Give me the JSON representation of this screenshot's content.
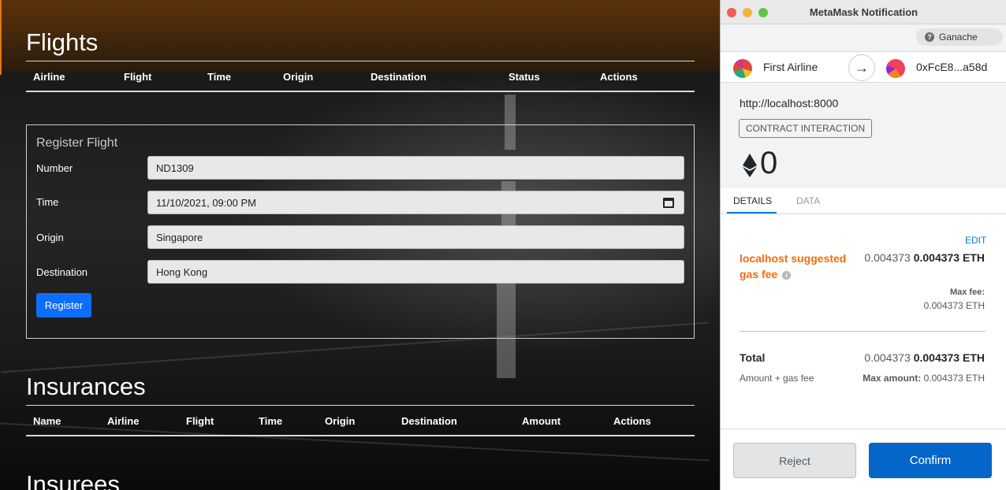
{
  "dapp": {
    "flights_title": "Flights",
    "flights_columns": [
      "Airline",
      "Flight",
      "Time",
      "Origin",
      "Destination",
      "Status",
      "Actions"
    ],
    "register": {
      "legend": "Register Flight",
      "fields": [
        {
          "label": "Number",
          "value": "ND1309"
        },
        {
          "label": "Time",
          "value": "11/10/2021, 09:00 PM"
        },
        {
          "label": "Origin",
          "value": "Singapore"
        },
        {
          "label": "Destination",
          "value": "Hong Kong"
        }
      ],
      "button_label": "Register"
    },
    "insurances_title": "Insurances",
    "insurances_columns": [
      "Name",
      "Airline",
      "Flight",
      "Time",
      "Origin",
      "Destination",
      "Amount",
      "Actions"
    ],
    "insurees_title": "Insurees"
  },
  "metamask": {
    "window_title": "MetaMask Notification",
    "network": "Ganache",
    "account_name": "First Airline",
    "recipient": "0xFcE8...a58d",
    "origin": "http://localhost:8000",
    "badge": "CONTRACT INTERACTION",
    "amount": "0",
    "tabs": {
      "details": "DETAILS",
      "data": "DATA"
    },
    "edit_label": "EDIT",
    "gas_label": "localhost suggested gas fee",
    "gas_fee_muted": "0.004373",
    "gas_fee_bold": "0.004373 ETH",
    "max_fee_label": "Max fee:",
    "max_fee_value": "0.004373 ETH",
    "total_label": "Total",
    "total_muted": "0.004373",
    "total_bold": "0.004373 ETH",
    "amount_gas_label": "Amount + gas fee",
    "max_amount_label": "Max amount:",
    "max_amount_value": "0.004373 ETH",
    "reject_label": "Reject",
    "confirm_label": "Confirm"
  },
  "colors": {
    "confirm": "#0366c8",
    "gas_warning": "#f66a0a",
    "register_button": "#0d6efd",
    "link": "#037dd6"
  },
  "icons": [
    "calendar-icon",
    "arrow-right-icon",
    "ethereum-icon",
    "info-icon",
    "question-icon"
  ]
}
